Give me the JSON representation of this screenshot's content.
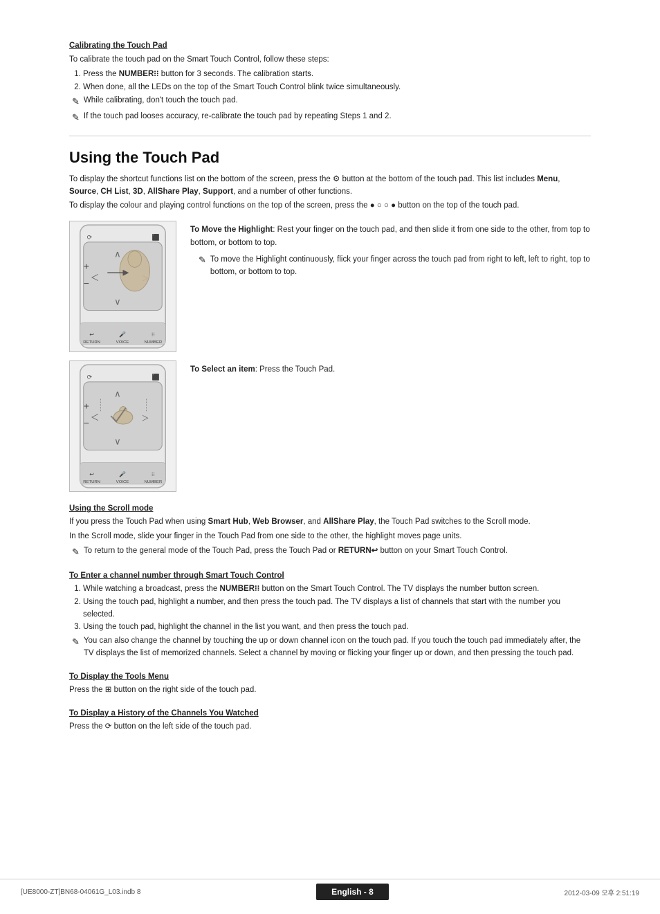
{
  "page": {
    "title": "Using the Touch Pad",
    "language_badge": "English - 8",
    "file_info": "[UE8000-ZT]BN68-04061G_L03.indb   8",
    "date_info": "2012-03-09   오후 2:51:19"
  },
  "calibrating": {
    "title": "Calibrating the Touch Pad",
    "intro": "To calibrate the touch pad on the Smart Touch Control, follow these steps:",
    "steps": [
      "Press the NUMBERⅡ button for 3 seconds. The calibration starts.",
      "When done, all the LEDs on the top of the Smart Touch Control blink twice simultaneously."
    ],
    "notes": [
      "While calibrating, don't touch the touch pad.",
      "If the touch pad looses accuracy, re-calibrate the touch pad by repeating Steps 1 and 2."
    ]
  },
  "using_touch_pad": {
    "title": "Using the Touch Pad",
    "intro1": "To display the shortcut functions list on the bottom of the screen, press the ⚙ button at the bottom of the touch pad. This list includes Menu, Source, CH List, 3D, AllShare Play, Support, and a number of other functions.",
    "intro2": "To display the colour and playing control functions on the top of the screen, press the ● ○ ○ ● button on the top of the touch pad.",
    "move_highlight_title": "To Move the Highlight",
    "move_highlight_desc": ": Rest your finger on the touch pad, and then slide it from one side to the other, from top to bottom, or bottom to top.",
    "move_highlight_note": "To move the Highlight continuously, flick your finger across the touch pad from right to left, left to right, top to bottom, or bottom to top.",
    "select_item_title": "To Select an item",
    "select_item_desc": ": Press the Touch Pad."
  },
  "scroll_mode": {
    "title": "Using the Scroll mode",
    "desc1": "If you press the Touch Pad when using Smart Hub, Web Browser, and AllShare Play, the Touch Pad switches to the Scroll mode.",
    "desc2": "In the Scroll mode, slide your finger in the Touch Pad from one side to the other, the highlight moves page units.",
    "note": "To return to the general mode of the Touch Pad, press the Touch Pad or RETURN↩ button on your Smart Touch Control."
  },
  "enter_channel": {
    "title": "To Enter a channel number through Smart Touch Control",
    "steps": [
      "While watching a broadcast, press the NUMBERⅡ button on the Smart Touch Control. The TV displays the number button screen.",
      "Using the touch pad, highlight a number, and then press the touch pad. The TV displays a list of channels that start with the number you selected.",
      "Using the touch pad, highlight the channel in the list you want, and then press the touch pad."
    ],
    "note": "You can also change the channel by touching the up or down channel icon on the touch pad. If you touch the touch pad immediately after, the TV displays the list of memorized channels. Select a channel by moving or flicking your finger up or down, and then pressing the touch pad."
  },
  "tools_menu": {
    "title": "To Display the Tools Menu",
    "desc": "Press the ⌗ button on the right side of the touch pad."
  },
  "history": {
    "title": "To Display a History of the Channels You Watched",
    "desc": "Press the ⟳ button on the left side of the touch pad."
  }
}
